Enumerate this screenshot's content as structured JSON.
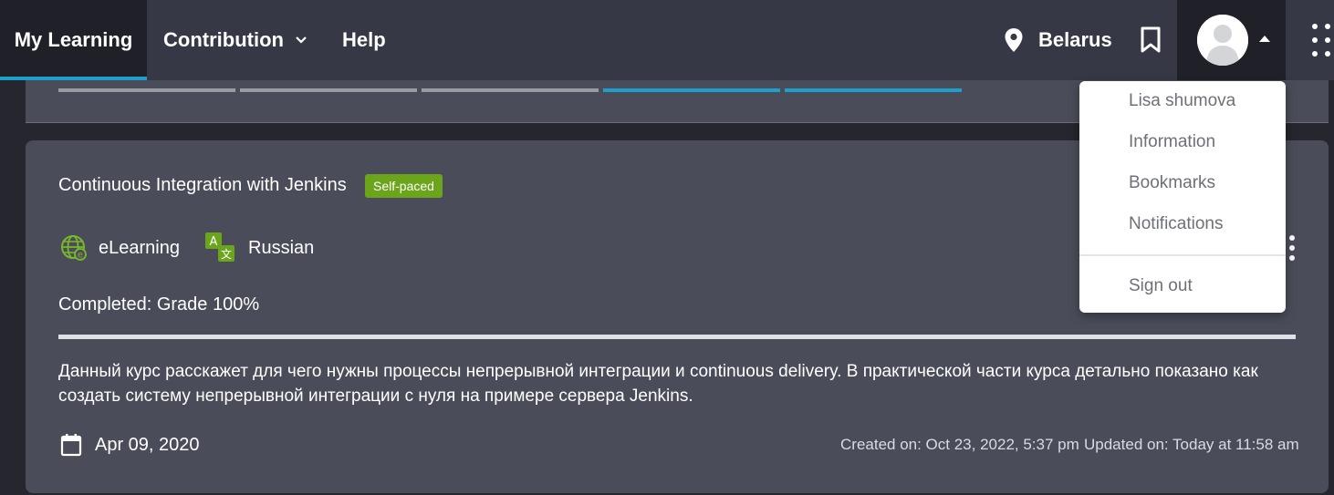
{
  "nav": {
    "my_learning": "My Learning",
    "contribution": "Contribution",
    "help": "Help",
    "location": "Belarus",
    "icons": {
      "location": "map-pin-icon",
      "bookmark": "bookmark-icon",
      "avatar": "user-avatar-icon",
      "apps": "apps-grid-icon",
      "caret": "caret-up-icon",
      "chevron": "chevron-down-icon"
    }
  },
  "progress_segments": [
    {
      "color": "#9a9ca4"
    },
    {
      "color": "#9a9ca4"
    },
    {
      "color": "#9a9ca4"
    },
    {
      "color": "#1e9fcb"
    },
    {
      "color": "#1e9fcb"
    }
  ],
  "course": {
    "title": "Continuous Integration with Jenkins",
    "badge": "Self-paced",
    "format": "eLearning",
    "language": "Russian",
    "completed": "Completed: Grade 100%",
    "description": "Данный курс расскажет для чего нужны процессы непрерывной интеграции и continuous delivery. В практической части курса детально показано как создать систему непрерывной интеграции с нуля на примере сервера Jenkins.",
    "date": "Apr 09, 2020",
    "created": "Created on: Oct 23, 2022, 5:37 pm",
    "updated": "Updated on: Today at 11:58 am"
  },
  "dropdown": {
    "user_name": "Lisa shumova",
    "items": [
      "Information",
      "Bookmarks",
      "Notifications"
    ],
    "sign_out": "Sign out"
  },
  "colors": {
    "accent": "#1e9fcb",
    "badge_green": "#6aa51b",
    "nav_bg": "#363845",
    "card_bg": "#4a4d59"
  }
}
